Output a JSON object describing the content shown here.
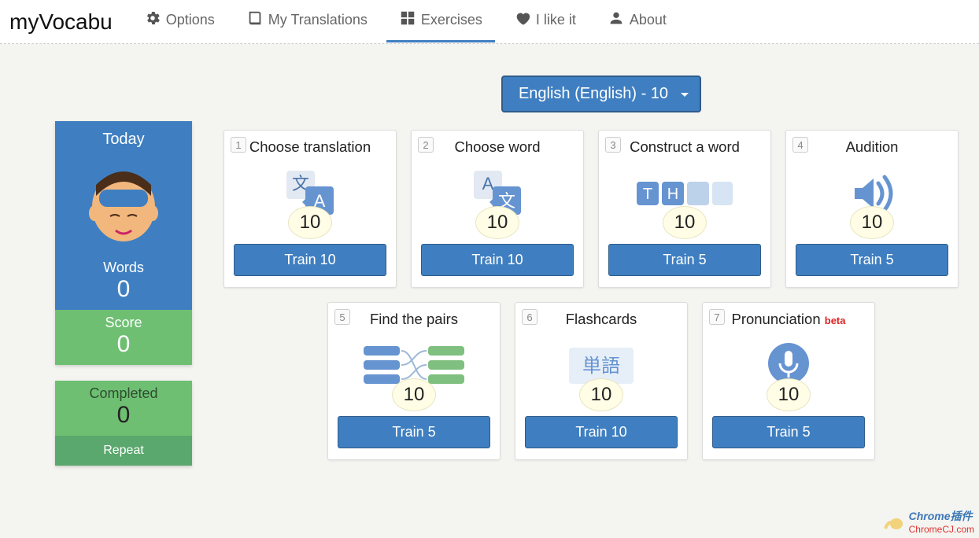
{
  "brand": "myVocabu",
  "nav": {
    "options": "Options",
    "translations": "My Translations",
    "exercises": "Exercises",
    "like": "I like it",
    "about": "About"
  },
  "sidebar": {
    "today_label": "Today",
    "words_label": "Words",
    "words_value": "0",
    "score_label": "Score",
    "score_value": "0",
    "completed_label": "Completed",
    "completed_value": "0",
    "repeat_label": "Repeat"
  },
  "lang_selector": "English (English) - 10",
  "cards": [
    {
      "num": "1",
      "title": "Choose translation",
      "count": "10",
      "button": "Train 10"
    },
    {
      "num": "2",
      "title": "Choose word",
      "count": "10",
      "button": "Train 10"
    },
    {
      "num": "3",
      "title": "Construct a word",
      "count": "10",
      "button": "Train 5"
    },
    {
      "num": "4",
      "title": "Audition",
      "count": "10",
      "button": "Train 5"
    },
    {
      "num": "5",
      "title": "Find the pairs",
      "count": "10",
      "button": "Train 5"
    },
    {
      "num": "6",
      "title": "Flashcards",
      "count": "10",
      "button": "Train 10"
    },
    {
      "num": "7",
      "title": "Pronunciation",
      "count": "10",
      "button": "Train 5",
      "beta": "beta"
    }
  ],
  "watermark": {
    "title": "Chrome插件",
    "url": "ChromeCJ.com"
  }
}
